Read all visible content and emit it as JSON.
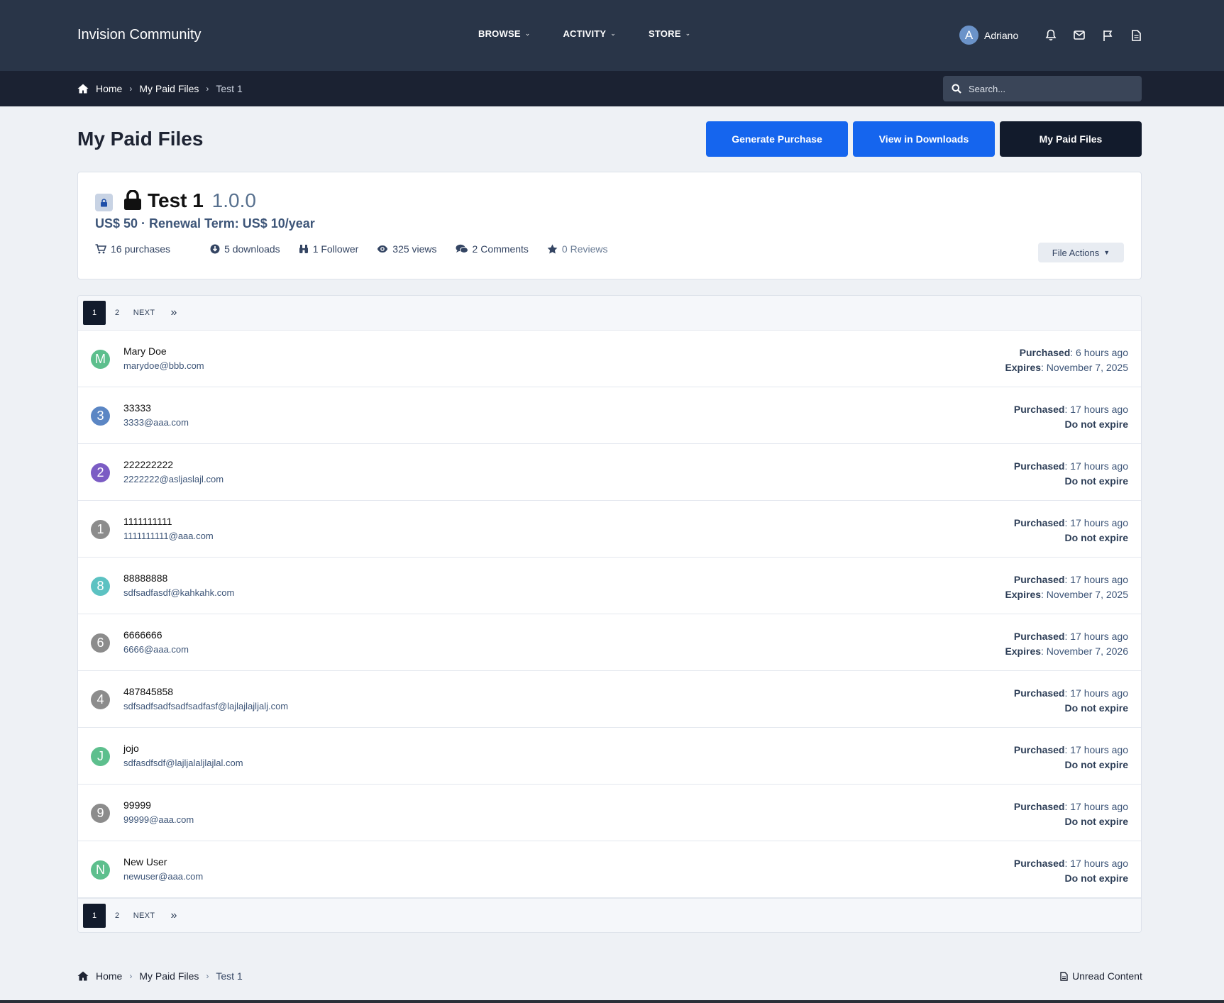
{
  "header": {
    "site_title": "Invision Community",
    "nav": [
      {
        "label": "BROWSE"
      },
      {
        "label": "ACTIVITY"
      },
      {
        "label": "STORE"
      }
    ],
    "user": {
      "initial": "A",
      "name": "Adriano",
      "avatar_color": "#6b93c9"
    }
  },
  "breadcrumb": {
    "home": "Home",
    "parent": "My Paid Files",
    "current": "Test 1"
  },
  "search": {
    "placeholder": "Search..."
  },
  "page": {
    "title": "My Paid Files",
    "buttons": {
      "generate": "Generate Purchase",
      "view_downloads": "View in Downloads",
      "my_paid_files": "My Paid Files"
    }
  },
  "file": {
    "title": "Test 1",
    "version": "1.0.0",
    "price_line": "US$ 50 · Renewal Term: US$ 10/year",
    "stats": {
      "purchases": "16 purchases",
      "downloads": "5 downloads",
      "followers": "1 Follower",
      "views": "325 views",
      "comments": "2 Comments",
      "reviews": "0 Reviews"
    },
    "actions_label": "File Actions"
  },
  "pagination": {
    "current": "1",
    "page2": "2",
    "next": "NEXT",
    "last": "»"
  },
  "labels": {
    "purchased": "Purchased",
    "expires": "Expires"
  },
  "purchases": [
    {
      "initial": "M",
      "color": "#5dbf8d",
      "name": "Mary Doe",
      "email": "marydoe@bbb.com",
      "purchased": ": 6 hours ago",
      "expiry_type": "expires",
      "expiry": ": November 7, 2025"
    },
    {
      "initial": "3",
      "color": "#5b86c4",
      "name": "33333",
      "email": "3333@aaa.com",
      "purchased": ": 17 hours ago",
      "expiry_type": "never",
      "expiry": "Do not expire"
    },
    {
      "initial": "2",
      "color": "#7b5cc4",
      "name": "222222222",
      "email": "2222222@asljaslajl.com",
      "purchased": ": 17 hours ago",
      "expiry_type": "never",
      "expiry": "Do not expire"
    },
    {
      "initial": "1",
      "color": "#8c8c8c",
      "name": "1111111111",
      "email": "1111111111@aaa.com",
      "purchased": ": 17 hours ago",
      "expiry_type": "never",
      "expiry": "Do not expire"
    },
    {
      "initial": "8",
      "color": "#5cc2c2",
      "name": "88888888",
      "email": "sdfsadfasdf@kahkahk.com",
      "purchased": ": 17 hours ago",
      "expiry_type": "expires",
      "expiry": ": November 7, 2025"
    },
    {
      "initial": "6",
      "color": "#8c8c8c",
      "name": "6666666",
      "email": "6666@aaa.com",
      "purchased": ": 17 hours ago",
      "expiry_type": "expires",
      "expiry": ": November 7, 2026"
    },
    {
      "initial": "4",
      "color": "#8c8c8c",
      "name": "487845858",
      "email": "sdfsadfsadfsadfsadfasf@lajlajlajljalj.com",
      "purchased": ": 17 hours ago",
      "expiry_type": "never",
      "expiry": "Do not expire"
    },
    {
      "initial": "J",
      "color": "#5dbf8d",
      "name": "jojo",
      "email": "sdfasdfsdf@lajljalaljlajlal.com",
      "purchased": ": 17 hours ago",
      "expiry_type": "never",
      "expiry": "Do not expire"
    },
    {
      "initial": "9",
      "color": "#8c8c8c",
      "name": "99999",
      "email": "99999@aaa.com",
      "purchased": ": 17 hours ago",
      "expiry_type": "never",
      "expiry": "Do not expire"
    },
    {
      "initial": "N",
      "color": "#5dbf8d",
      "name": "New User",
      "email": "newuser@aaa.com",
      "purchased": ": 17 hours ago",
      "expiry_type": "never",
      "expiry": "Do not expire"
    }
  ],
  "footer": {
    "unread": "Unread Content"
  },
  "colors": {
    "header_bg": "#293548",
    "breadcrumb_bg": "#1b2232",
    "primary_button": "#1565ee",
    "dark_button": "#121b2c"
  }
}
